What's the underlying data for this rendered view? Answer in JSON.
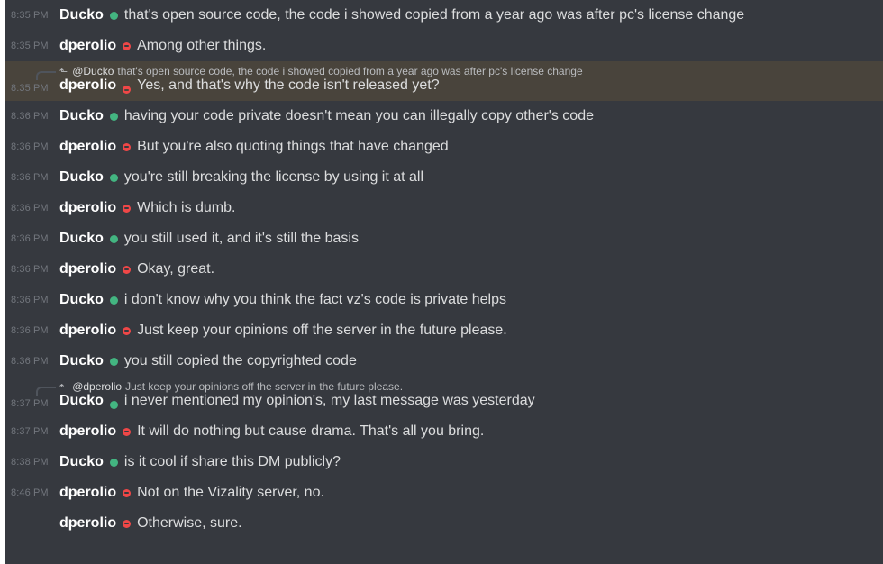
{
  "colors": {
    "background": "#36393f",
    "highlight": "#49443c",
    "online": "#43b581",
    "dnd": "#f04747",
    "timestamp": "#72767d",
    "text": "#dcddde"
  },
  "messages": [
    {
      "time": "8:35 PM",
      "author": "Ducko",
      "status": "online",
      "text": "that's open source code, the code i showed copied from a year ago was after pc's license change"
    },
    {
      "time": "8:35 PM",
      "author": "dperolio",
      "status": "dnd",
      "text": "Among other things."
    },
    {
      "time": "8:35 PM",
      "author": "dperolio",
      "status": "dnd",
      "text": "Yes, and that's why the code isn't released yet?",
      "highlighted": true,
      "reply": {
        "mention": "@Ducko",
        "text": "that's open source code, the code i showed copied from a year ago was after pc's license change"
      }
    },
    {
      "time": "8:36 PM",
      "author": "Ducko",
      "status": "online",
      "text": "having your code private doesn't mean you can illegally copy other's code"
    },
    {
      "time": "8:36 PM",
      "author": "dperolio",
      "status": "dnd",
      "text": "But you're also quoting things that have changed"
    },
    {
      "time": "8:36 PM",
      "author": "Ducko",
      "status": "online",
      "text": "you're still breaking the license by using it at all"
    },
    {
      "time": "8:36 PM",
      "author": "dperolio",
      "status": "dnd",
      "text": "Which is dumb."
    },
    {
      "time": "8:36 PM",
      "author": "Ducko",
      "status": "online",
      "text": "you still used it, and it's still the basis"
    },
    {
      "time": "8:36 PM",
      "author": "dperolio",
      "status": "dnd",
      "text": "Okay, great."
    },
    {
      "time": "8:36 PM",
      "author": "Ducko",
      "status": "online",
      "text": "i don't know why you think the fact vz's code is private helps"
    },
    {
      "time": "8:36 PM",
      "author": "dperolio",
      "status": "dnd",
      "text": "Just keep your opinions off the server in the future please."
    },
    {
      "time": "8:36 PM",
      "author": "Ducko",
      "status": "online",
      "text": "you still copied the copyrighted code"
    },
    {
      "time": "8:37 PM",
      "author": "Ducko",
      "status": "online",
      "text": "i never mentioned my opinion's, my last message was yesterday",
      "reply": {
        "mention": "@dperolio",
        "text": "Just keep your opinions off the server in the future please."
      }
    },
    {
      "time": "8:37 PM",
      "author": "dperolio",
      "status": "dnd",
      "text": "It will do nothing but cause drama. That's all you bring."
    },
    {
      "time": "8:38 PM",
      "author": "Ducko",
      "status": "online",
      "text": "is it cool if share this DM publicly?"
    },
    {
      "time": "8:46 PM",
      "author": "dperolio",
      "status": "dnd",
      "text": "Not on the Vizality server, no."
    },
    {
      "time": "",
      "author": "dperolio",
      "status": "dnd",
      "text": "Otherwise, sure."
    }
  ]
}
